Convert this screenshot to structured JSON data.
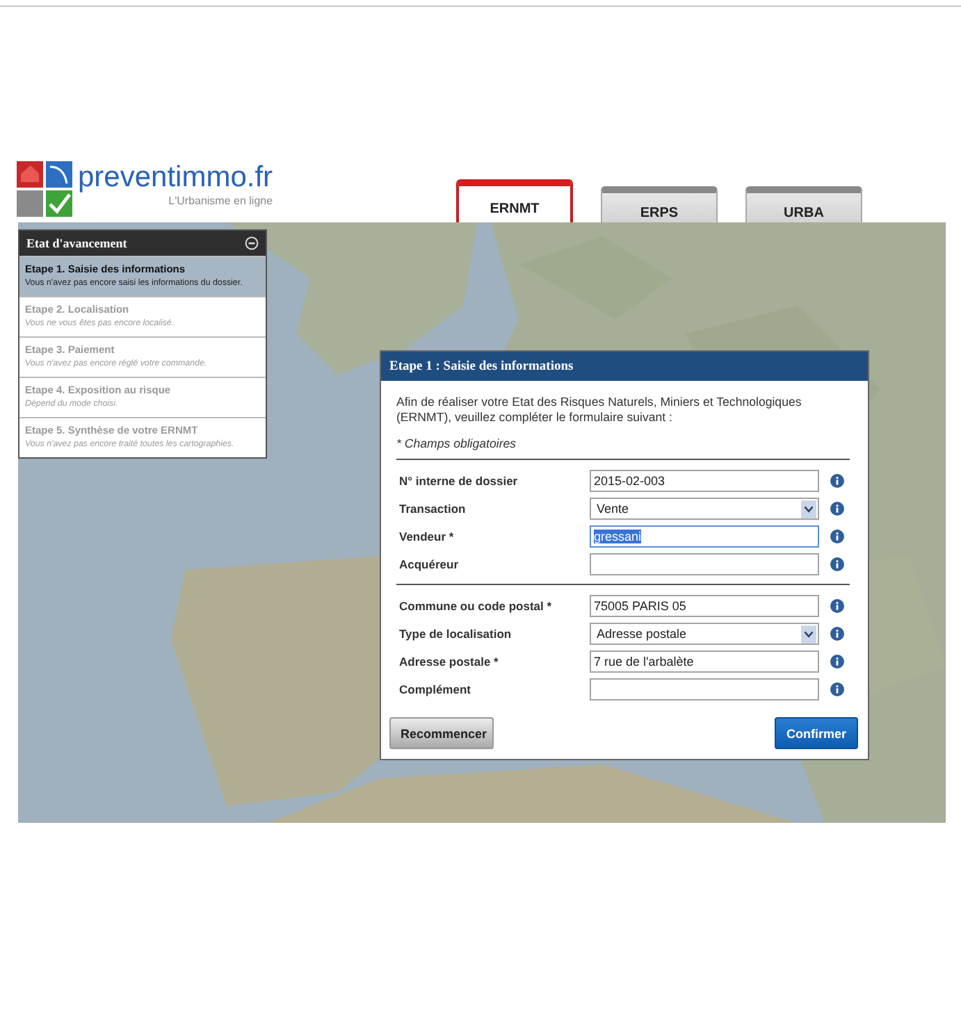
{
  "logo": {
    "name": "preventimmo.fr",
    "tagline": "L'Urbanisme en ligne"
  },
  "tabs": [
    {
      "label": "ERNMT",
      "selected": true
    },
    {
      "label": "ERPS",
      "selected": false
    },
    {
      "label": "URBA",
      "selected": false
    }
  ],
  "progress_panel": {
    "title": "Etat d'avancement",
    "steps": [
      {
        "title": "Etape 1. Saisie des informations",
        "description": "Vous n'avez pas encore saisi les informations du dossier.",
        "selected": true
      },
      {
        "title": "Etape 2. Localisation",
        "description": "Vous ne vous êtes pas encore localisé.",
        "selected": false
      },
      {
        "title": "Etape 3. Paiement",
        "description": "Vous n'avez pas encore réglé votre commande.",
        "selected": false
      },
      {
        "title": "Etape 4. Exposition au risque",
        "description": "Dépend du mode choisi.",
        "selected": false
      },
      {
        "title": "Etape 5. Synthèse de votre ERNMT",
        "description": "Vous n'avez pas encore traité toutes les cartographies.",
        "selected": false
      }
    ]
  },
  "dialog": {
    "title": "Etape 1 : Saisie des informations",
    "intro": "Afin de réaliser votre Etat des Risques Naturels, Miniers et Technologiques (ERNMT), veuillez compléter le formulaire suivant :",
    "required_note": "* Champs obligatoires",
    "field_groups": [
      [
        {
          "label": "N° interne de dossier",
          "kind": "text",
          "value": "2015-02-003",
          "focused": false
        },
        {
          "label": "Transaction",
          "kind": "select",
          "value": "Vente",
          "focused": false
        },
        {
          "label": "Vendeur *",
          "kind": "text",
          "value": "gressani",
          "focused": true
        },
        {
          "label": "Acquéreur",
          "kind": "text",
          "focused": false
        }
      ],
      [
        {
          "label": "Commune ou code postal *",
          "kind": "text",
          "value": "75005 PARIS 05",
          "focused": false
        },
        {
          "label": "Type de localisation",
          "kind": "select",
          "value": "Adresse postale",
          "focused": false
        },
        {
          "label": "Adresse postale *",
          "kind": "text",
          "value": "7 rue de l'arbalète",
          "focused": false
        },
        {
          "label": "Complément",
          "kind": "text",
          "focused": false
        }
      ]
    ],
    "buttons": [
      {
        "label": "Recommencer",
        "kind": "secondary"
      },
      {
        "label": "Confirmer",
        "kind": "primary"
      }
    ]
  }
}
